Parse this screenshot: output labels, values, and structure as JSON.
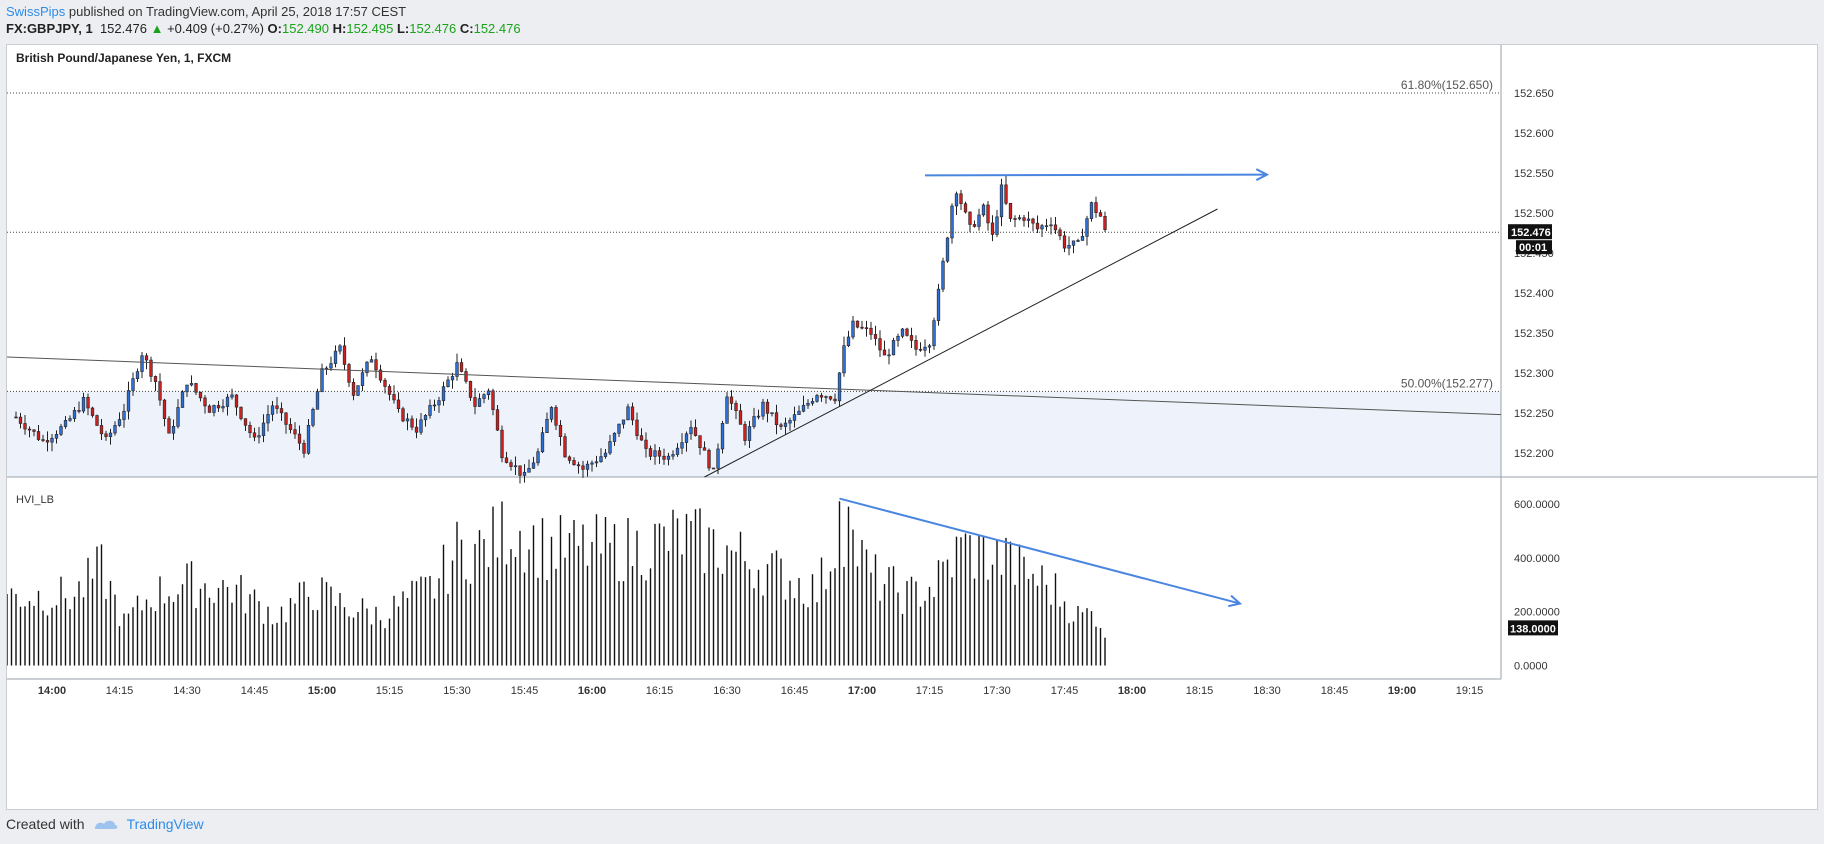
{
  "header": {
    "publisher": "SwissPips",
    "published_text": "published on TradingView.com, April 25, 2018 17:57 CEST",
    "symbol": "FX:GBPJPY, 1",
    "last": "152.476",
    "change_arrow": "▲",
    "change": "+0.409 (+0.27%)",
    "o_label": "O:",
    "o_value": "152.490",
    "h_label": "H:",
    "h_value": "152.495",
    "l_label": "L:",
    "l_value": "152.476",
    "c_label": "C:",
    "c_value": "152.476"
  },
  "chart": {
    "title": "British Pound/Japanese Yen, 1, FXCM",
    "indicator_title": "HVI_LB",
    "price_badge": "152.476",
    "time_badge": "00:01",
    "volume_badge": "138.0000",
    "fib_618_label": "61.80%(152.650)",
    "fib_500_label": "50.00%(152.277)"
  },
  "footer": {
    "created_with": "Created with",
    "brand": "TradingView"
  },
  "colors": {
    "up": "#2e6fd6",
    "down": "#cc1f1f",
    "wick": "#222222",
    "annotation_blue": "#4a86e0",
    "zone_fill": "#eef3fb",
    "accent_green": "#1aa31a"
  },
  "chart_data": {
    "type": "candlestick",
    "symbol": "GBPJPY",
    "timeframe": "1",
    "price_axis": {
      "ylim": [
        152.17,
        152.71
      ],
      "ticks": [
        "152.650",
        "152.600",
        "152.550",
        "152.500",
        "152.450",
        "152.400",
        "152.350",
        "152.300",
        "152.250",
        "152.200"
      ]
    },
    "volume_axis": {
      "ylim": [
        -50,
        700
      ],
      "ticks": [
        "600.0000",
        "400.0000",
        "200.0000",
        "0.0000"
      ]
    },
    "time_axis": {
      "ticks": [
        "14:00",
        "14:15",
        "14:30",
        "14:45",
        "15:00",
        "15:15",
        "15:30",
        "15:45",
        "16:00",
        "16:15",
        "16:30",
        "16:45",
        "17:00",
        "17:15",
        "17:30",
        "17:45",
        "18:00",
        "18:15",
        "18:30",
        "18:45",
        "19:00",
        "19:15"
      ],
      "bold_ticks": [
        "14:00",
        "15:00",
        "16:00",
        "17:00",
        "18:00",
        "19:00"
      ],
      "start_minute": 830,
      "end_minute": 1162
    },
    "candle_anchors": [
      {
        "t": 832,
        "p": 152.245
      },
      {
        "t": 838,
        "p": 152.215
      },
      {
        "t": 843,
        "p": 152.235
      },
      {
        "t": 847,
        "p": 152.265
      },
      {
        "t": 852,
        "p": 152.215
      },
      {
        "t": 856,
        "p": 152.255
      },
      {
        "t": 860,
        "p": 152.325
      },
      {
        "t": 863,
        "p": 152.29
      },
      {
        "t": 866,
        "p": 152.22
      },
      {
        "t": 870,
        "p": 152.29
      },
      {
        "t": 875,
        "p": 152.255
      },
      {
        "t": 880,
        "p": 152.27
      },
      {
        "t": 885,
        "p": 152.215
      },
      {
        "t": 889,
        "p": 152.26
      },
      {
        "t": 896,
        "p": 152.205
      },
      {
        "t": 900,
        "p": 152.3
      },
      {
        "t": 904,
        "p": 152.33
      },
      {
        "t": 907,
        "p": 152.275
      },
      {
        "t": 911,
        "p": 152.32
      },
      {
        "t": 917,
        "p": 152.25
      },
      {
        "t": 921,
        "p": 152.23
      },
      {
        "t": 926,
        "p": 152.27
      },
      {
        "t": 930,
        "p": 152.31
      },
      {
        "t": 934,
        "p": 152.26
      },
      {
        "t": 937,
        "p": 152.28
      },
      {
        "t": 940,
        "p": 152.2
      },
      {
        "t": 945,
        "p": 152.17
      },
      {
        "t": 948,
        "p": 152.2
      },
      {
        "t": 951,
        "p": 152.26
      },
      {
        "t": 954,
        "p": 152.2
      },
      {
        "t": 958,
        "p": 152.18
      },
      {
        "t": 963,
        "p": 152.2
      },
      {
        "t": 968,
        "p": 152.255
      },
      {
        "t": 972,
        "p": 152.2
      },
      {
        "t": 977,
        "p": 152.195
      },
      {
        "t": 982,
        "p": 152.235
      },
      {
        "t": 987,
        "p": 152.175
      },
      {
        "t": 990,
        "p": 152.275
      },
      {
        "t": 994,
        "p": 152.22
      },
      {
        "t": 998,
        "p": 152.26
      },
      {
        "t": 1002,
        "p": 152.23
      },
      {
        "t": 1006,
        "p": 152.25
      },
      {
        "t": 1010,
        "p": 152.275
      },
      {
        "t": 1014,
        "p": 152.27
      },
      {
        "t": 1016,
        "p": 152.33
      },
      {
        "t": 1018,
        "p": 152.36
      },
      {
        "t": 1022,
        "p": 152.35
      },
      {
        "t": 1025,
        "p": 152.32
      },
      {
        "t": 1029,
        "p": 152.35
      },
      {
        "t": 1032,
        "p": 152.33
      },
      {
        "t": 1035,
        "p": 152.34
      },
      {
        "t": 1037,
        "p": 152.4
      },
      {
        "t": 1040,
        "p": 152.51
      },
      {
        "t": 1041,
        "p": 152.53
      },
      {
        "t": 1044,
        "p": 152.48
      },
      {
        "t": 1047,
        "p": 152.505
      },
      {
        "t": 1049,
        "p": 152.47
      },
      {
        "t": 1051,
        "p": 152.53
      },
      {
        "t": 1053,
        "p": 152.49
      },
      {
        "t": 1056,
        "p": 152.495
      },
      {
        "t": 1059,
        "p": 152.48
      },
      {
        "t": 1062,
        "p": 152.49
      },
      {
        "t": 1065,
        "p": 152.46
      },
      {
        "t": 1068,
        "p": 152.46
      },
      {
        "t": 1071,
        "p": 152.51
      },
      {
        "t": 1073,
        "p": 152.496
      },
      {
        "t": 1074,
        "p": 152.476
      }
    ],
    "volume_anchors": [
      {
        "t": 830,
        "v": 280
      },
      {
        "t": 845,
        "v": 280
      },
      {
        "t": 851,
        "v": 390
      },
      {
        "t": 856,
        "v": 170
      },
      {
        "t": 862,
        "v": 280
      },
      {
        "t": 870,
        "v": 330
      },
      {
        "t": 880,
        "v": 310
      },
      {
        "t": 890,
        "v": 200
      },
      {
        "t": 898,
        "v": 300
      },
      {
        "t": 905,
        "v": 240
      },
      {
        "t": 913,
        "v": 200
      },
      {
        "t": 925,
        "v": 320
      },
      {
        "t": 930,
        "v": 460
      },
      {
        "t": 936,
        "v": 470
      },
      {
        "t": 942,
        "v": 560
      },
      {
        "t": 950,
        "v": 470
      },
      {
        "t": 960,
        "v": 470
      },
      {
        "t": 970,
        "v": 470
      },
      {
        "t": 980,
        "v": 520
      },
      {
        "t": 990,
        "v": 460
      },
      {
        "t": 1000,
        "v": 380
      },
      {
        "t": 1010,
        "v": 300
      },
      {
        "t": 1016,
        "v": 560
      },
      {
        "t": 1022,
        "v": 360
      },
      {
        "t": 1030,
        "v": 280
      },
      {
        "t": 1036,
        "v": 320
      },
      {
        "t": 1042,
        "v": 470
      },
      {
        "t": 1050,
        "v": 430
      },
      {
        "t": 1058,
        "v": 360
      },
      {
        "t": 1063,
        "v": 300
      },
      {
        "t": 1068,
        "v": 200
      },
      {
        "t": 1072,
        "v": 210
      },
      {
        "t": 1074,
        "v": 138
      }
    ],
    "volume_spikes": [
      {
        "t": 1015,
        "v": 610
      },
      {
        "t": 1017,
        "v": 590
      },
      {
        "t": 1053,
        "v": 460
      },
      {
        "t": 1043,
        "v": 490
      }
    ],
    "horizontal_lines": [
      {
        "label": "61.80%(152.650)",
        "price": 152.65,
        "style": "dotted"
      },
      {
        "label": "50.00%(152.277)",
        "price": 152.277,
        "style": "dotted"
      },
      {
        "label": "current",
        "price": 152.476,
        "style": "dotted"
      }
    ],
    "zone": {
      "from_price": 152.277,
      "to_price": 152.17
    },
    "trend_lines": [
      {
        "from": {
          "t": 830,
          "p": 152.32
        },
        "to": {
          "t": 1162,
          "p": 152.248
        },
        "color": "#555555"
      },
      {
        "from": {
          "t": 985,
          "p": 152.17
        },
        "to": {
          "t": 1099,
          "p": 152.505
        },
        "color": "#222222"
      }
    ],
    "arrows": [
      {
        "pane": "price",
        "from": {
          "t": 1034,
          "p": 152.547
        },
        "to": {
          "t": 1110,
          "p": 152.548
        }
      },
      {
        "pane": "volume",
        "from": {
          "t": 1015,
          "v": 620
        },
        "to": {
          "t": 1104,
          "v": 230
        }
      }
    ]
  }
}
